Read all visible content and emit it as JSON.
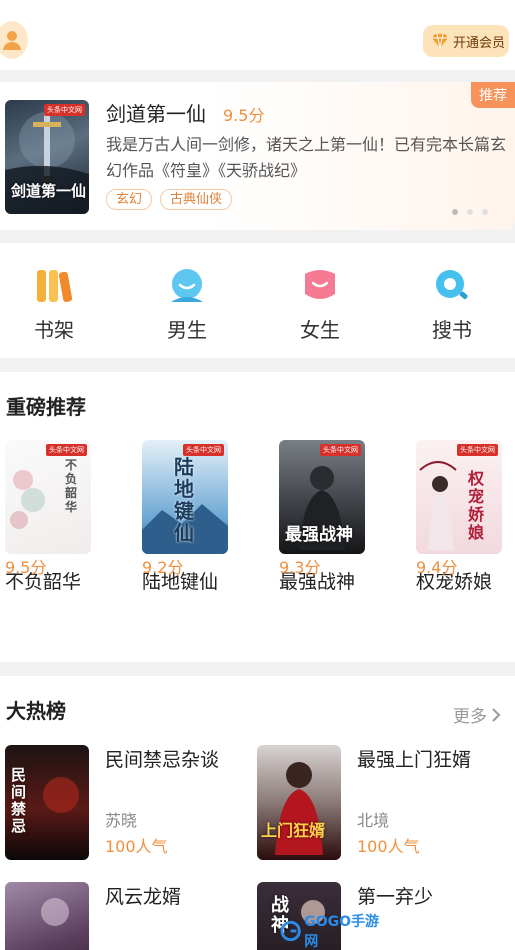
{
  "header": {
    "vip_label": "开通会员"
  },
  "banner": {
    "title": "剑道第一仙",
    "score": "9.5分",
    "description": "我是万古人间一剑修，诸天之上第一仙！已有完本长篇玄幻作品《符皇》《天骄战纪》",
    "tags": [
      "玄幻",
      "古典仙侠"
    ],
    "badge": "推荐",
    "cover_title": "剑道第一仙",
    "publisher": "头条中文网"
  },
  "nav": [
    {
      "label": "书架",
      "icon": "bookshelf-icon"
    },
    {
      "label": "男生",
      "icon": "male-icon"
    },
    {
      "label": "女生",
      "icon": "female-icon"
    },
    {
      "label": "搜书",
      "icon": "search-icon"
    }
  ],
  "recommend": {
    "title": "重磅推荐",
    "books": [
      {
        "name": "不负韶华",
        "score": "9.5分",
        "cover_title": "不负韶华",
        "publisher": "头条中文网"
      },
      {
        "name": "陆地键仙",
        "score": "9.2分",
        "cover_title": "陆地键仙",
        "publisher": "头条中文网"
      },
      {
        "name": "最强战神",
        "score": "9.3分",
        "cover_title": "最强战神",
        "publisher": "头条中文网"
      },
      {
        "name": "权宠娇娘",
        "score": "9.4分",
        "cover_title": "权宠娇娘",
        "publisher": "头条中文网"
      }
    ]
  },
  "hot": {
    "title": "大热榜",
    "more_label": "更多",
    "books": [
      {
        "name": "民间禁忌杂谈",
        "author": "苏晓",
        "popularity": "100人气",
        "cover_title": "民间禁忌"
      },
      {
        "name": "最强上门狂婿",
        "author": "北境",
        "popularity": "100人气",
        "cover_title": "上门狂婿"
      },
      {
        "name": "风云龙婿",
        "author": "",
        "popularity": "",
        "cover_title": ""
      },
      {
        "name": "第一弃少",
        "author": "",
        "popularity": "",
        "cover_title": "战神"
      }
    ]
  },
  "watermark": {
    "text": "GOGO手游网"
  },
  "colors": {
    "accent": "#f0903f",
    "vip_bg": "#fde3b9",
    "badge": "#f7935a"
  }
}
